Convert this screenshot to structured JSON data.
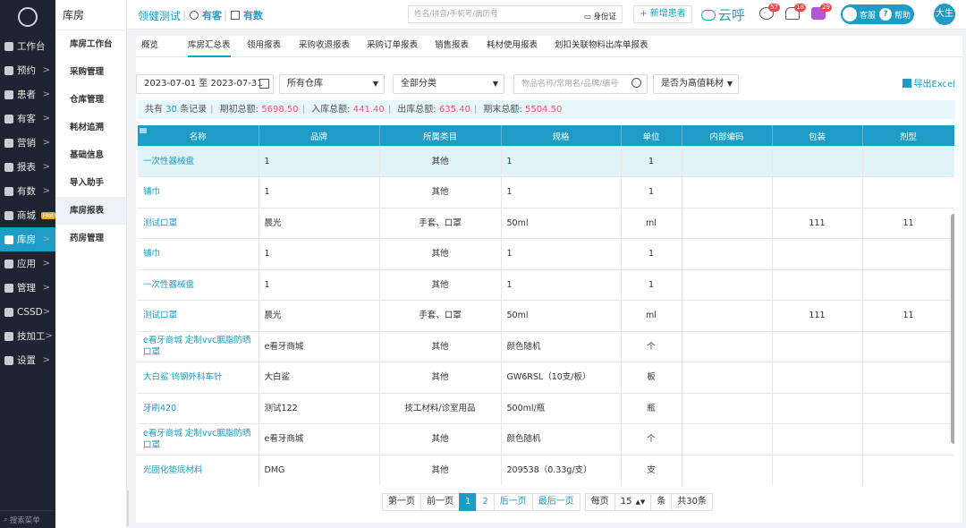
{
  "nav": {
    "items": [
      {
        "label": "工作台",
        "arrow": false
      },
      {
        "label": "预约",
        "arrow": true
      },
      {
        "label": "患者",
        "arrow": true
      },
      {
        "label": "有客",
        "arrow": true
      },
      {
        "label": "营销",
        "arrow": true
      },
      {
        "label": "报表",
        "arrow": true
      },
      {
        "label": "有数",
        "arrow": true
      },
      {
        "label": "商城",
        "arrow": false,
        "badge": "Hot"
      },
      {
        "label": "库房",
        "arrow": true,
        "active": true
      },
      {
        "label": "应用",
        "arrow": true
      },
      {
        "label": "管理",
        "arrow": true
      },
      {
        "label": "CSSD",
        "arrow": true
      },
      {
        "label": "技加工",
        "arrow": true
      },
      {
        "label": "设置",
        "arrow": true
      }
    ],
    "search": "搜索菜单"
  },
  "sub": {
    "title": "库房",
    "items": [
      "库房工作台",
      "采购管理",
      "仓库管理",
      "耗材追溯",
      "基础信息",
      "导入助手",
      "库房报表",
      "药房管理"
    ]
  },
  "top": {
    "brand": "领健测试",
    "youke": "有客",
    "youshu": "有数",
    "search_placeholder": "姓名/拼音/手机号/病历号",
    "idcard": "身份证",
    "new_patient": "+ 新增患者",
    "cloud": "云呼",
    "badges": [
      "57",
      "18",
      "29"
    ],
    "service": "客服",
    "help": "帮助",
    "help_q": "?",
    "avatar": "大生"
  },
  "tabs": [
    "概览",
    "库房汇总表",
    "领用报表",
    "采购收退报表",
    "采购订单报表",
    "销售报表",
    "耗材使用报表",
    "划扣关联物料出库单报表"
  ],
  "filters": {
    "date_range": "2023-07-01 至 2023-07-31",
    "warehouse": "所有仓库",
    "category": "全部分类",
    "item_search_placeholder": "物品名称/常用名/品牌/编号",
    "high_value": "是否为高值耗材",
    "export": "导出Excel"
  },
  "summary": {
    "prefix": "共有",
    "count": "30",
    "count_suffix": "条记录",
    "open_label": "期初总额:",
    "open": "5698.50",
    "in_label": "入库总额:",
    "in": "441.40",
    "out_label": "出库总额:",
    "out": "635.40",
    "end_label": "期末总额:",
    "end": "5504.50"
  },
  "table": {
    "columns": [
      "名称",
      "品牌",
      "所属类目",
      "规格",
      "单位",
      "内部编码",
      "包装",
      "剂型"
    ],
    "rows": [
      [
        "一次性器械盘",
        "1",
        "其他",
        "1",
        "1",
        "",
        "",
        ""
      ],
      [
        "铺巾",
        "1",
        "其他",
        "1",
        "1",
        "",
        "",
        ""
      ],
      [
        "测试口罩",
        "晨光",
        "手套、口罩",
        "50ml",
        "ml",
        "",
        "111",
        "11"
      ],
      [
        "铺巾",
        "1",
        "其他",
        "1",
        "1",
        "",
        "",
        ""
      ],
      [
        "一次性器械盘",
        "1",
        "其他",
        "1",
        "1",
        "",
        "",
        ""
      ],
      [
        "测试口罩",
        "晨光",
        "手套、口罩",
        "50ml",
        "ml",
        "",
        "111",
        "11"
      ],
      [
        "e看牙商城 定制vvc胭脂防晒口罩",
        "e看牙商城",
        "其他",
        "颜色随机",
        "个",
        "",
        "",
        ""
      ],
      [
        "大白鲨 钨钢外科车针",
        "大白鲨",
        "其他",
        "GW6RSL（10支/板）",
        "板",
        "",
        "",
        ""
      ],
      [
        "牙刷420",
        "测试122",
        "技工材料/诊室用品",
        "500ml/瓶",
        "瓶",
        "",
        "",
        ""
      ],
      [
        "e看牙商城 定制vvc胭脂防晒口罩",
        "e看牙商城",
        "其他",
        "颜色随机",
        "个",
        "",
        "",
        ""
      ],
      [
        "光固化垫底材料",
        "DMG",
        "其他",
        "209538（0.33g/支）",
        "支",
        "",
        "",
        ""
      ]
    ]
  },
  "pager": {
    "first": "第一页",
    "prev": "前一页",
    "pages": [
      "1",
      "2"
    ],
    "current": "1",
    "next": "后一页",
    "last": "最后一页",
    "per_page_label": "每页",
    "per_page": "15",
    "unit": "条",
    "total": "共30条"
  }
}
